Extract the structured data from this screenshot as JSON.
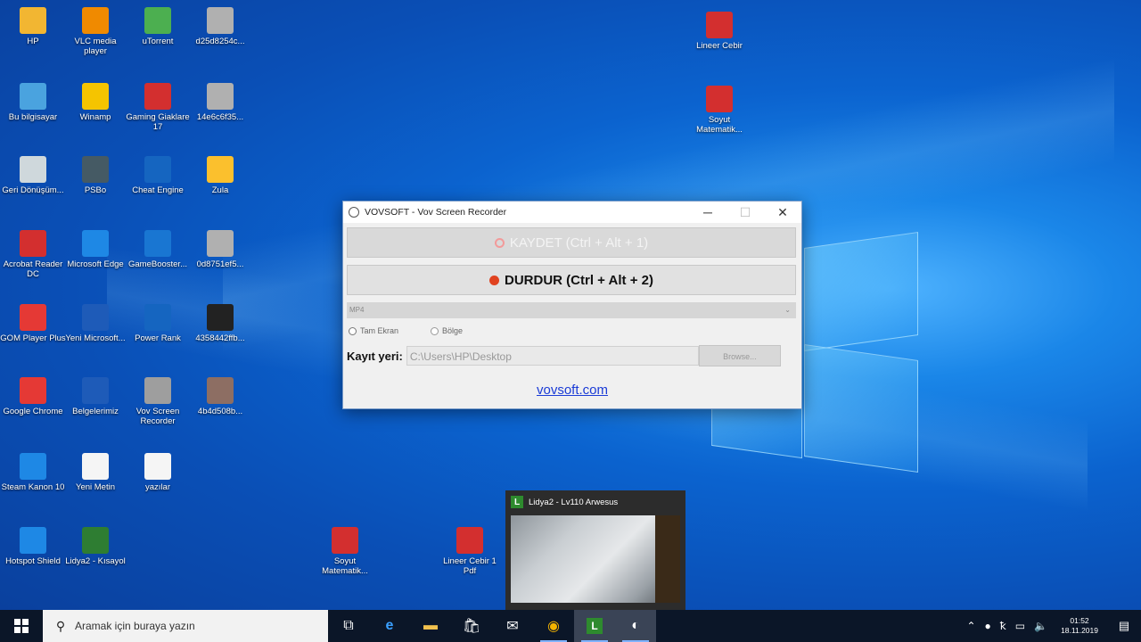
{
  "desktop": {
    "icons": [
      {
        "label": "HP",
        "glyph": "folder-icon",
        "color": "#f2b632"
      },
      {
        "label": "VLC media player",
        "glyph": "vlc-icon",
        "color": "#f08a00"
      },
      {
        "label": "uTorrent",
        "glyph": "utorrent-icon",
        "color": "#4caf50"
      },
      {
        "label": "d25d8254c...",
        "glyph": "file-icon",
        "color": "#b0b0b0"
      },
      {
        "label": "Bu bilgisayar",
        "glyph": "computer-icon",
        "color": "#4aa3df"
      },
      {
        "label": "Winamp",
        "glyph": "winamp-icon",
        "color": "#f5c400"
      },
      {
        "label": "Gaming Giaklare 17",
        "glyph": "game-icon",
        "color": "#d32f2f"
      },
      {
        "label": "14e6c6f35...",
        "glyph": "file-icon",
        "color": "#b0b0b0"
      },
      {
        "label": "Geri Dönüşüm...",
        "glyph": "recycle-bin-icon",
        "color": "#cfd8dc"
      },
      {
        "label": "PSBo",
        "glyph": "app-icon",
        "color": "#455a64"
      },
      {
        "label": "Cheat Engine",
        "glyph": "cheat-engine-icon",
        "color": "#1565c0"
      },
      {
        "label": "Zula",
        "glyph": "zula-icon",
        "color": "#fbc02d"
      },
      {
        "label": "Acrobat Reader DC",
        "glyph": "acrobat-icon",
        "color": "#d32f2f"
      },
      {
        "label": "Microsoft Edge",
        "glyph": "edge-icon",
        "color": "#1e88e5"
      },
      {
        "label": "GameBooster...",
        "glyph": "gamebooster-icon",
        "color": "#1976d2"
      },
      {
        "label": "0d8751ef5...",
        "glyph": "file-icon",
        "color": "#b0b0b0"
      },
      {
        "label": "GOM Player Plus",
        "glyph": "gom-icon",
        "color": "#e53935"
      },
      {
        "label": "Yeni Microsoft...",
        "glyph": "word-doc-icon",
        "color": "#1e5bb8"
      },
      {
        "label": "Power Rank",
        "glyph": "powerrank-icon",
        "color": "#1565c0"
      },
      {
        "label": "4358442ffb...",
        "glyph": "monitor-icon",
        "color": "#222222"
      },
      {
        "label": "Google Chrome",
        "glyph": "chrome-icon",
        "color": "#e53935"
      },
      {
        "label": "Belgelerimiz",
        "glyph": "word-doc-icon",
        "color": "#1e5bb8"
      },
      {
        "label": "Vov Screen Recorder",
        "glyph": "recorder-icon",
        "color": "#9e9e9e"
      },
      {
        "label": "4b4d508b...",
        "glyph": "app-icon",
        "color": "#8d6e63"
      },
      {
        "label": "Steam Kanon 10",
        "glyph": "app-icon",
        "color": "#1e88e5"
      },
      {
        "label": "Yeni Metin",
        "glyph": "text-file-icon",
        "color": "#f5f5f5"
      },
      {
        "label": "yazılar",
        "glyph": "text-file-icon",
        "color": "#f5f5f5"
      },
      {
        "label": "Hotspot Shield",
        "glyph": "shield-icon",
        "color": "#1e88e5"
      },
      {
        "label": "Lidya2 - Kısayol",
        "glyph": "lidya-icon",
        "color": "#2e7d32"
      },
      {
        "label": "Soyut Matematik...",
        "glyph": "pdf-icon",
        "color": "#d32f2f"
      },
      {
        "label": "Lineer Cebir 1 Pdf",
        "glyph": "pdf-icon",
        "color": "#d32f2f"
      },
      {
        "label": "Lineer Cebir",
        "glyph": "pdf-icon",
        "color": "#d32f2f"
      },
      {
        "label": "Soyut Matematik...",
        "glyph": "pdf-icon",
        "color": "#d32f2f"
      }
    ]
  },
  "recorder": {
    "title": "VOVSOFT - Vov Screen Recorder",
    "minimize": "─",
    "maximize": "☐",
    "close": "✕",
    "record_label": "KAYDET (Ctrl + Alt + 1)",
    "stop_label": "DURDUR (Ctrl + Alt + 2)",
    "format": "MP4",
    "radio_full": "Tam Ekran",
    "radio_region": "Bölge",
    "save_label": "Kayıt yeri:",
    "save_path": "C:\\Users\\HP\\Desktop",
    "browse_label": "Browse...",
    "link": "vovsoft.com"
  },
  "preview": {
    "title": "Lidya2 - Lv110 Arwesus"
  },
  "taskbar": {
    "search_placeholder": "Aramak için buraya yazın",
    "clock_time": "01:52",
    "clock_date": "18.11.2019"
  }
}
